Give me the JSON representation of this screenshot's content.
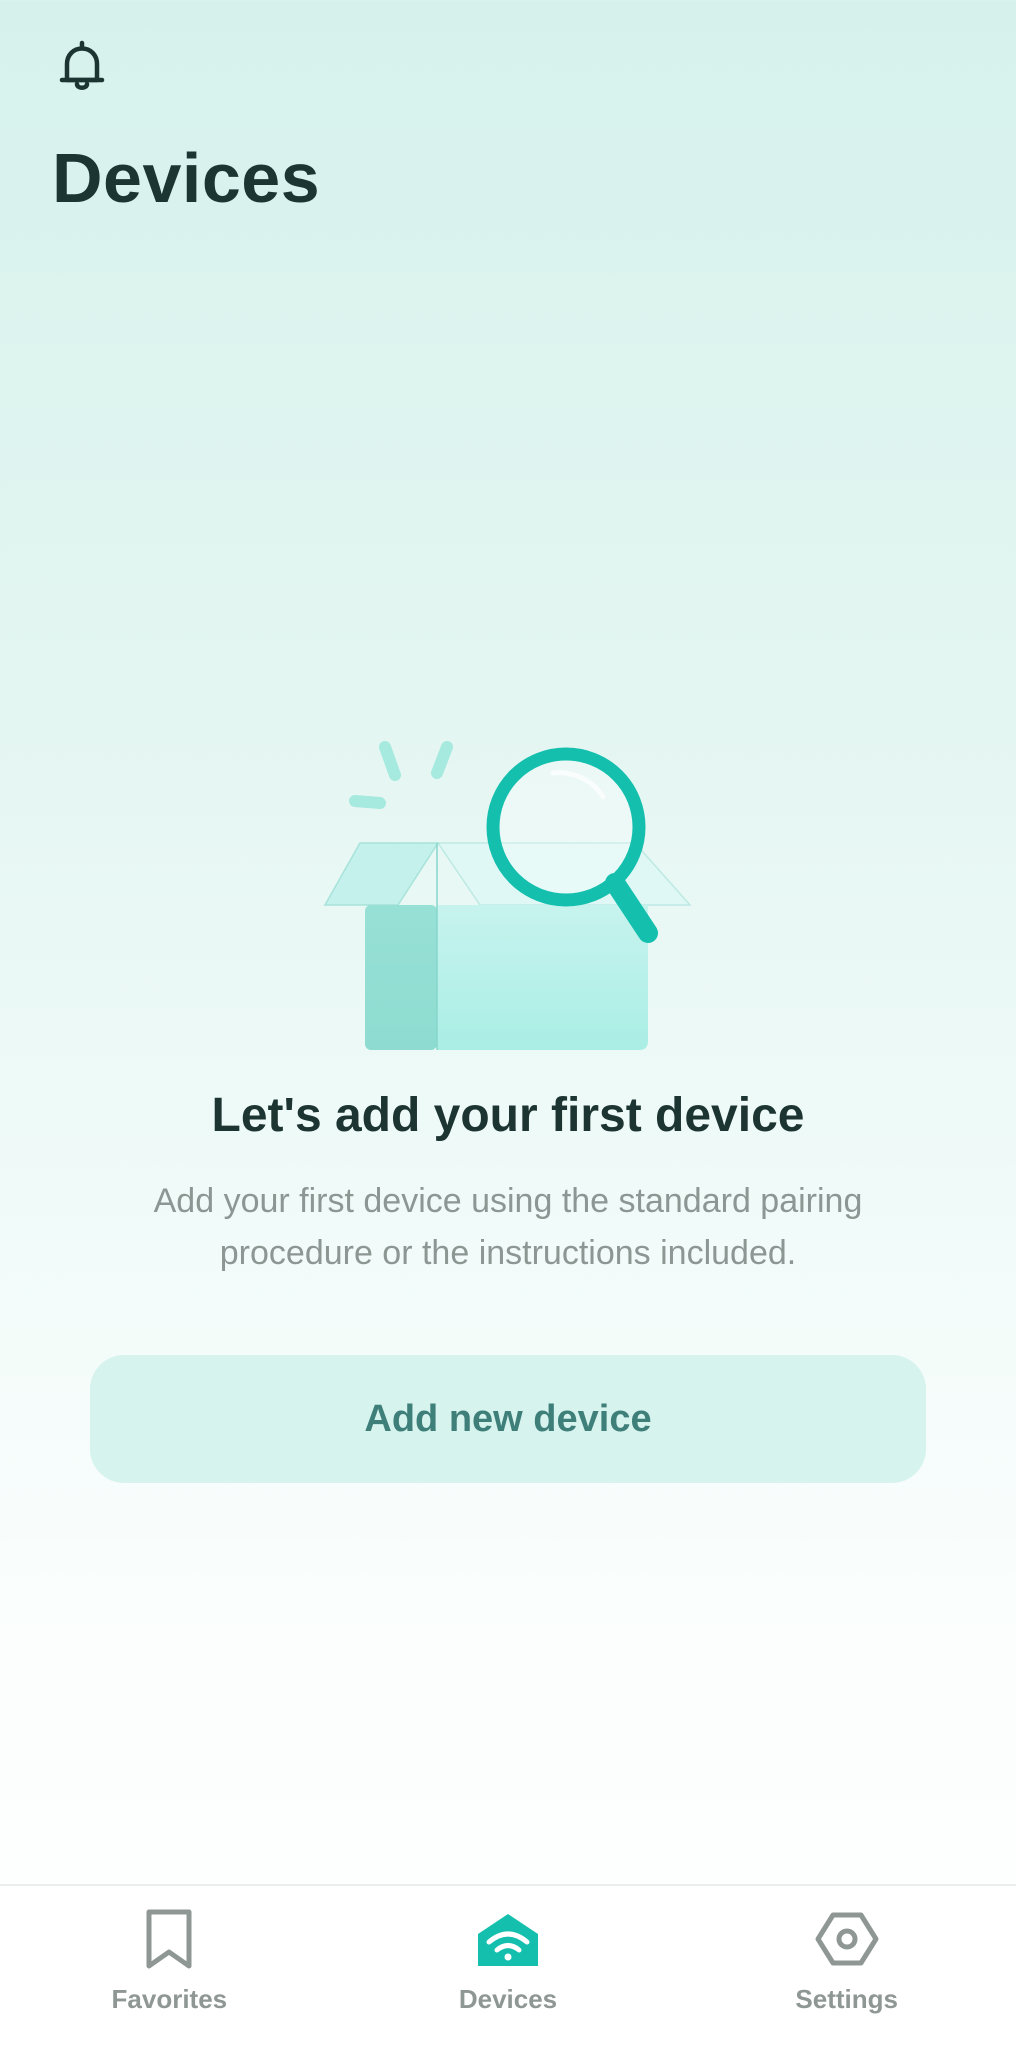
{
  "header": {
    "notification_icon": "bell-icon",
    "title": "Devices"
  },
  "empty_state": {
    "illustration": "open-box-with-magnifier",
    "title": "Let's add your first device",
    "description": "Add your first device using the standard pairing procedure or the instructions included.",
    "add_button_label": "Add new device"
  },
  "bottom_nav": {
    "items": [
      {
        "label": "Favorites",
        "icon": "bookmark-icon",
        "active": false
      },
      {
        "label": "Devices",
        "icon": "home-wifi-icon",
        "active": true
      },
      {
        "label": "Settings",
        "icon": "hexagon-gear-icon",
        "active": false
      }
    ]
  },
  "colors": {
    "accent": "#14bfae",
    "text_dark": "#1d3532",
    "text_muted": "#8c9693",
    "button_bg": "#d6f3ee",
    "button_text": "#3f7f7a",
    "nav_inactive": "#8f9794"
  }
}
